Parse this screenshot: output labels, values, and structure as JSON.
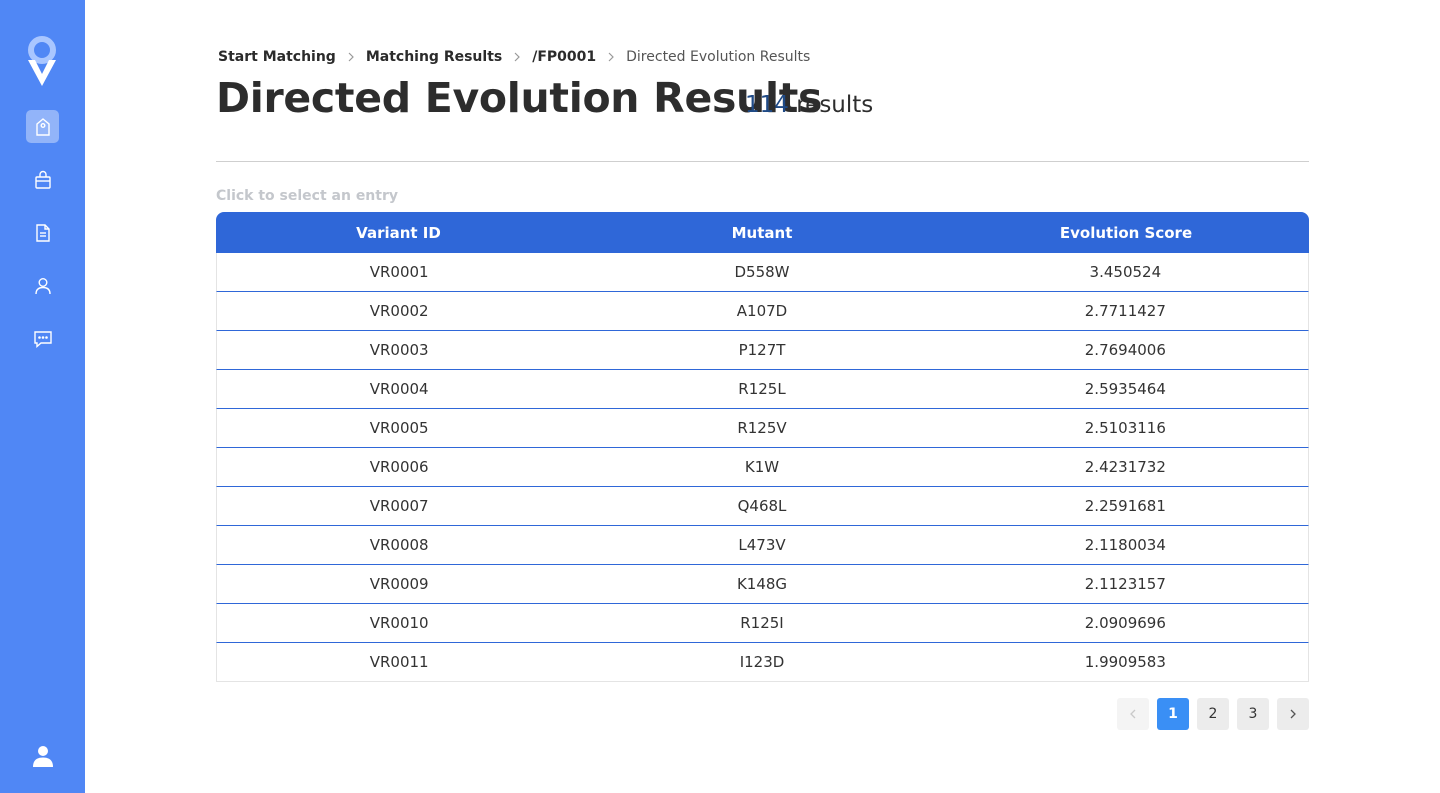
{
  "breadcrumb": {
    "items": [
      {
        "label": "Start Matching"
      },
      {
        "label": "Matching Results"
      },
      {
        "label": "/FP0001"
      },
      {
        "label": "Directed Evolution Results"
      }
    ]
  },
  "page": {
    "title": "Directed Evolution Results",
    "result_count": "114",
    "result_label": "results",
    "hint": "Click to select an entry"
  },
  "table": {
    "columns": [
      "Variant ID",
      "Mutant",
      "Evolution Score"
    ],
    "rows": [
      [
        "VR0001",
        "D558W",
        "3.450524"
      ],
      [
        "VR0002",
        "A107D",
        "2.7711427"
      ],
      [
        "VR0003",
        "P127T",
        "2.7694006"
      ],
      [
        "VR0004",
        "R125L",
        "2.5935464"
      ],
      [
        "VR0005",
        "R125V",
        "2.5103116"
      ],
      [
        "VR0006",
        "K1W",
        "2.4231732"
      ],
      [
        "VR0007",
        "Q468L",
        "2.2591681"
      ],
      [
        "VR0008",
        "L473V",
        "2.1180034"
      ],
      [
        "VR0009",
        "K148G",
        "2.1123157"
      ],
      [
        "VR0010",
        "R125I",
        "2.0909696"
      ],
      [
        "VR0011",
        "I123D",
        "1.9909583"
      ]
    ]
  },
  "pagination": {
    "pages": [
      "1",
      "2",
      "3"
    ],
    "current": "1"
  },
  "sidebar": {
    "icons": [
      "tag-icon",
      "shopping-bag-icon",
      "document-icon",
      "user-icon",
      "chat-icon"
    ],
    "bottom_icon": "profile-icon"
  },
  "colors": {
    "sidebar": "#5087f5",
    "table_header": "#2f67d8",
    "page_active": "#3a8ff5",
    "count": "#1f4a86"
  }
}
